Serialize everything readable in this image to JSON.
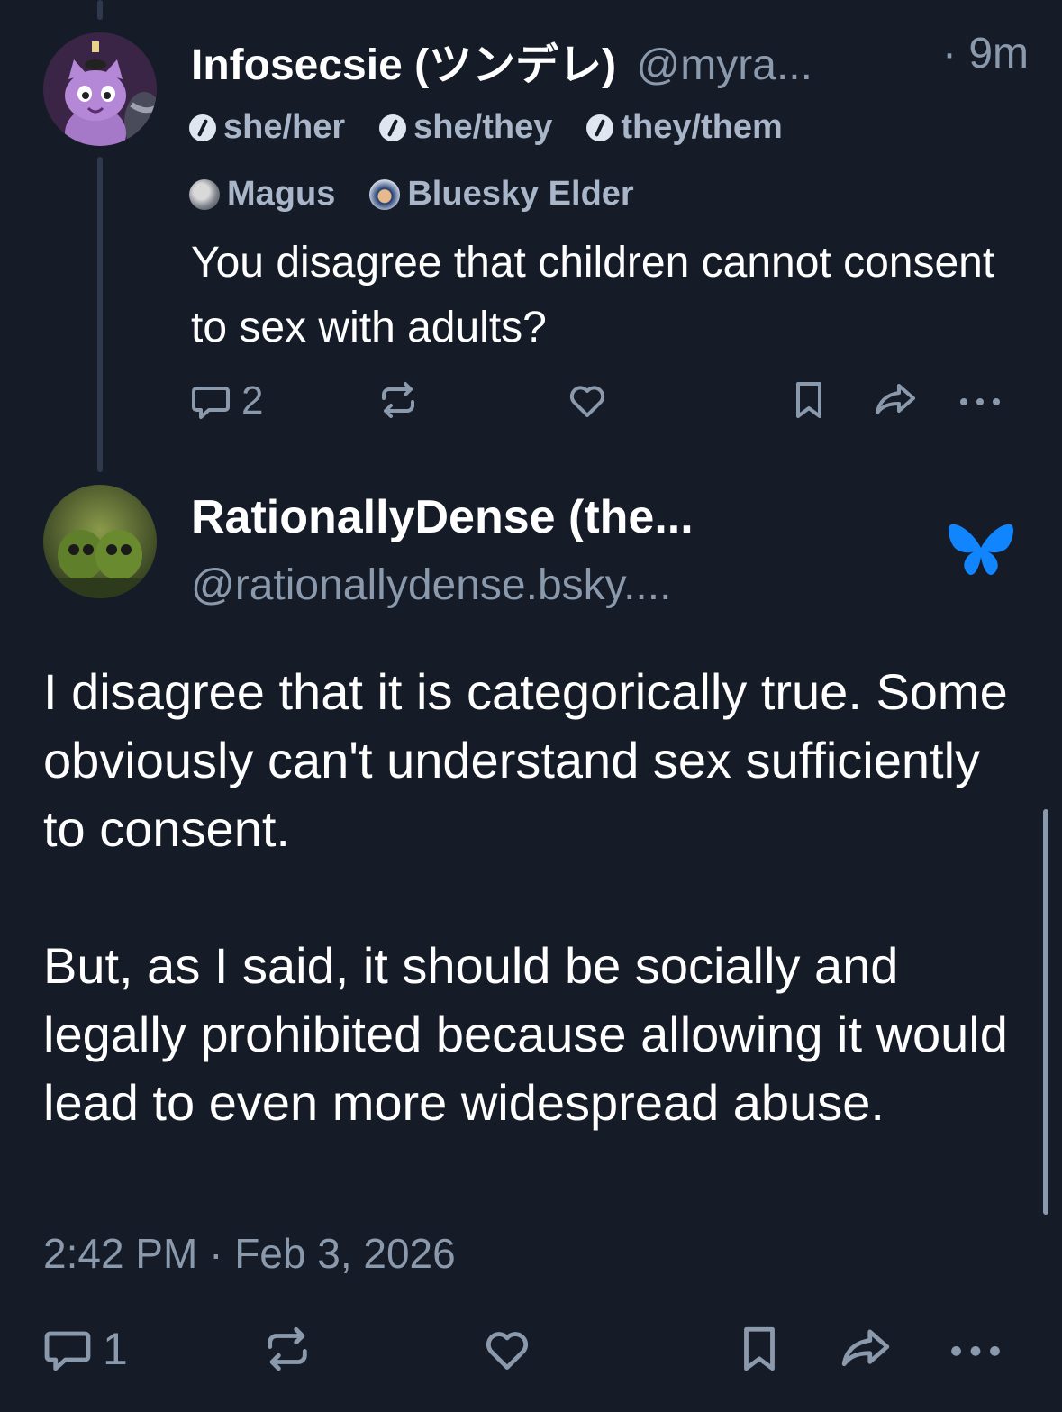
{
  "colors": {
    "background": "#161c27",
    "muted_text": "#8b99ad",
    "thread_line": "#2e3a4c",
    "bluesky_blue": "#1185fe"
  },
  "parent_post": {
    "display_name": "Infosecsie (ツンデレ)",
    "handle": "@myra...",
    "time": "· 9m",
    "pronoun_badges": [
      "she/her",
      "she/they",
      "they/them"
    ],
    "label_badges": [
      {
        "label": "Magus",
        "icon": "magus-icon"
      },
      {
        "label": "Bluesky Elder",
        "icon": "elder-icon"
      }
    ],
    "text": "You disagree that children cannot consent to sex with adults?",
    "reply_count": "2"
  },
  "main_post": {
    "display_name": "RationallyDense (the...",
    "handle": "@rationallydense.bsky....",
    "paragraph_1": "I disagree that it is categorically true. Some obviously can't understand sex sufficiently to consent.",
    "paragraph_2": "But, as I said, it should be socially and legally prohibited because allowing it would lead to even more widespread abuse.",
    "timestamp": "2:42 PM · Feb 3, 2026",
    "reply_count": "1"
  }
}
